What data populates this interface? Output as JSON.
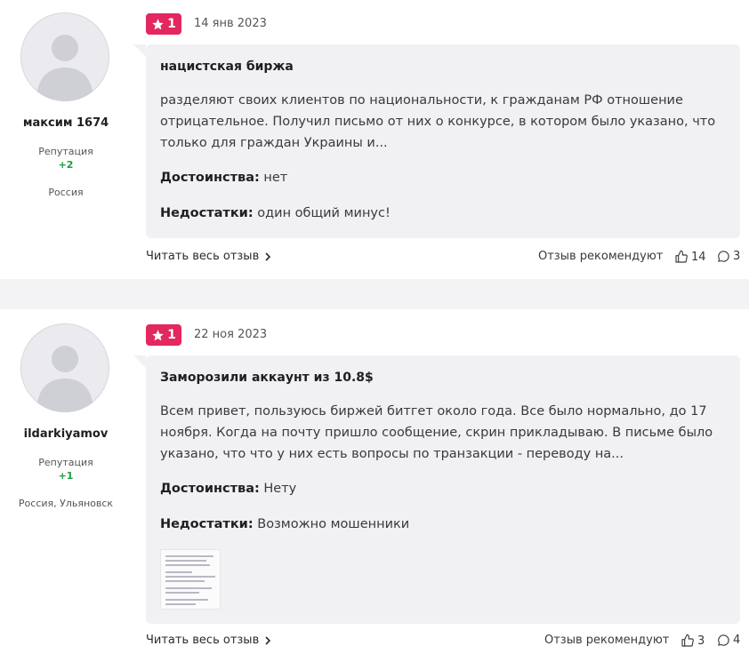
{
  "reviews": [
    {
      "author": "максим 1674",
      "reputation_label": "Репутация",
      "reputation_value": "+2",
      "location": "Россия",
      "rating": "1",
      "date": "14 янв 2023",
      "title": "нацистская биржа",
      "text": "разделяют своих клиентов по национальности, к гражданам РФ отношение отрицательное. Получил письмо от них о конкурсе, в котором было указано, что только для граждан Украины и...",
      "pros_label": "Достоинства:",
      "pros": "нет",
      "cons_label": "Недостатки:",
      "cons": "один общий минус!",
      "read_more": "Читать весь отзыв",
      "recommend_label": "Отзыв рекомендуют",
      "likes": "14",
      "comments": "3"
    },
    {
      "author": "ildarkiyamov",
      "reputation_label": "Репутация",
      "reputation_value": "+1",
      "location": "Россия, Ульяновск",
      "rating": "1",
      "date": "22 ноя 2023",
      "title": "Заморозили аккаунт из 10.8$",
      "text": "Всем привет, пользуюсь биржей битгет около года. Все было нормально, до 17 ноября. Когда на почту пришло сообщение, скрин прикладываю. В письме было указано, что что у них есть вопросы по транзакции - переводу на...",
      "pros_label": "Достоинства:",
      "pros": "Нету",
      "cons_label": "Недостатки:",
      "cons": "Возможно мошенники",
      "read_more": "Читать весь отзыв",
      "recommend_label": "Отзыв рекомендуют",
      "likes": "3",
      "comments": "4"
    }
  ],
  "colors": {
    "rating_badge": "#e3275f",
    "reputation_positive": "#1b9e3e",
    "bubble_bg": "#f1f1f4",
    "separator": "#f3f3f6"
  }
}
